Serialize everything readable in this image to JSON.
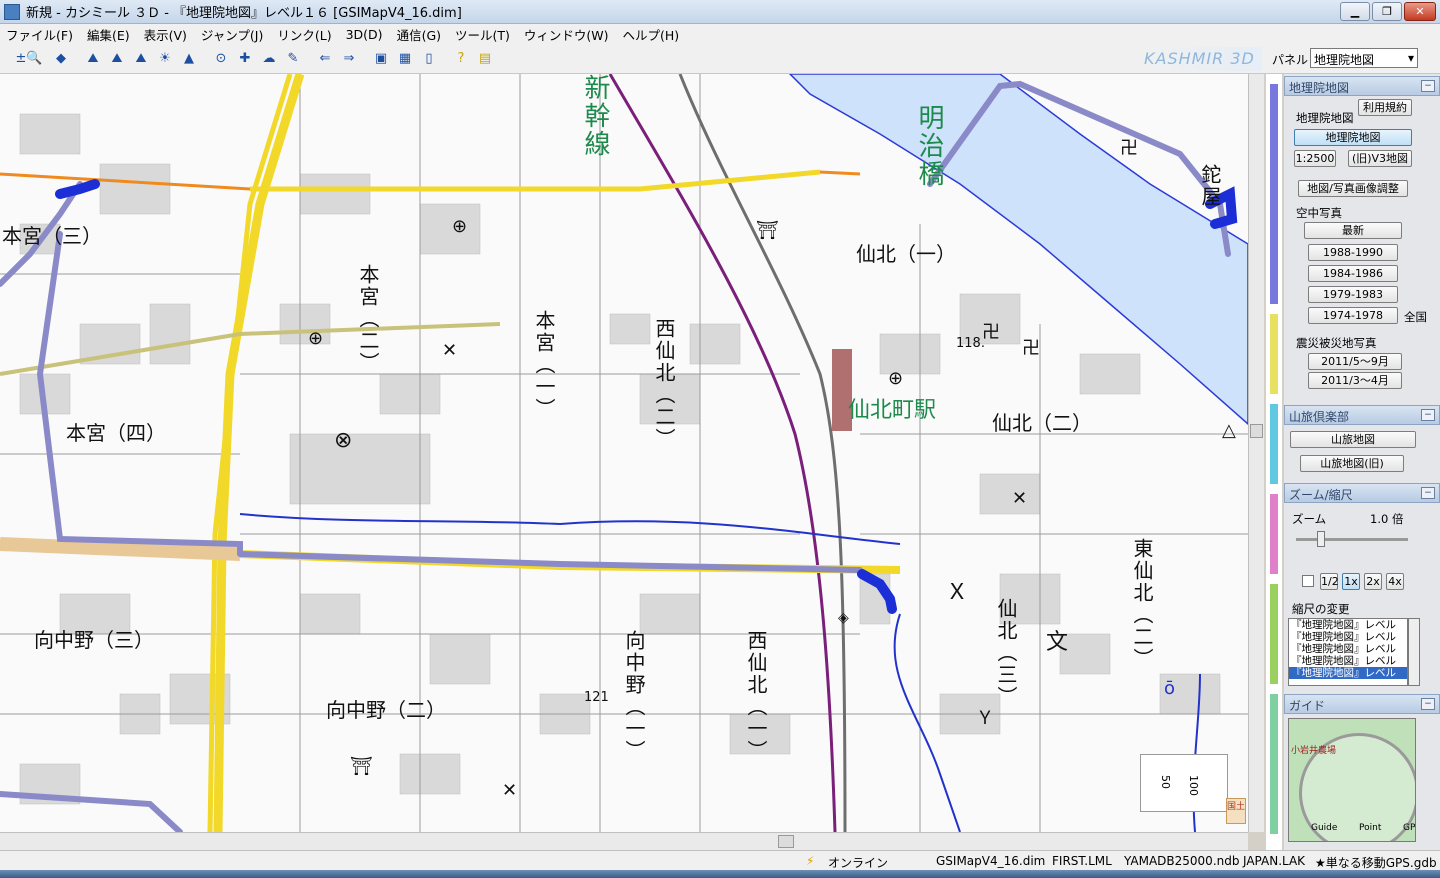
{
  "window": {
    "title": "新規 - カシミール ３Ｄ - 『地理院地図』レベル１６ [GSIMapV4_16.dim]"
  },
  "menu": [
    "ファイル(F)",
    "編集(E)",
    "表示(V)",
    "ジャンプ(J)",
    "リンク(L)",
    "3D(D)",
    "通信(G)",
    "ツール(T)",
    "ウィンドウ(W)",
    "ヘルプ(H)"
  ],
  "toolbar": {
    "brand": "KASHMIR 3D",
    "panel_label": "パネル",
    "panel_value": "地理院地図"
  },
  "map": {
    "labels": {
      "motomiya3": "本宮（三）",
      "motomiya4": "本宮（四）",
      "mukainakano3": "向中野（三）",
      "mukainakano2": "向中野（二）",
      "senboku1": "仙北（一）",
      "senboku2": "仙北（二）",
      "station": "仙北町駅"
    },
    "vlabels": {
      "motomiya2": "本宮（二）",
      "motomiya1": "本宮（一）",
      "nishisenboku2": "西仙北（二）",
      "nishisenboku1": "西仙北（一）",
      "mukainakano1": "向中野（一）",
      "senboku3": "仙北（三）",
      "higashisenboku2": "東仙北（二）",
      "shinkansen": "新幹線",
      "meijibashi": "明治橋"
    },
    "elevations": {
      "e1": "118.",
      "e2": "121"
    },
    "store": "鉈屋",
    "scale_50": "50",
    "scale_100": "100",
    "gsi_logo": "国土"
  },
  "panel": {
    "gsi": {
      "header": "地理院地図",
      "terms_button": "利用規約",
      "label": "地理院地図",
      "gsi_map_button": "地理院地図",
      "scale_2500_button": "1:2500",
      "old_v3_button": "(旧)V3地図",
      "photo_adjust_button": "地図/写真画像調整",
      "aerial_label": "空中写真",
      "aerial_latest": "最新",
      "aerial_1988": "1988-1990",
      "aerial_1984": "1984-1986",
      "aerial_1979": "1979-1983",
      "aerial_1974": "1974-1978",
      "aerial_all": "全国",
      "disaster_label": "震災被災地写真",
      "disaster_may": "2011/5～9月",
      "disaster_march": "2011/3～4月"
    },
    "sanryo": {
      "header": "山旅倶楽部",
      "map_button": "山旅地図",
      "old_map_button": "山旅地図(旧)"
    },
    "zoom": {
      "header": "ズーム/縮尺",
      "zoom_label": "ズーム",
      "zoom_value": "1.0 倍",
      "half": "1/2",
      "x1": "1x",
      "x2": "2x",
      "x4": "4x",
      "scale_change": "縮尺の変更",
      "scale_list": [
        "『地理院地図』レベル",
        "『地理院地図』レベル",
        "『地理院地図』レベル",
        "『地理院地図』レベル",
        "『地理院地図』レベル"
      ]
    },
    "guide": {
      "header": "ガイド",
      "place": "小岩井農場",
      "tab_guide": "Guide",
      "tab_point": "Point",
      "tab_gps": "GP"
    }
  },
  "status": {
    "online": "オンライン",
    "dim": "GSIMapV4_16.dim",
    "lml": "FIRST.LML",
    "ndb": "YAMADB25000.ndb",
    "lak": "JAPAN.LAK",
    "gdb": "★単なる移動GPS.gdb"
  },
  "colors": {
    "river": "#cfe2fb",
    "road_yellow": "#f2d829",
    "road_orange": "#f08a1e",
    "track": "#1c2ed6",
    "route": "#8a8ac8",
    "rail": "#7a1f7a"
  }
}
